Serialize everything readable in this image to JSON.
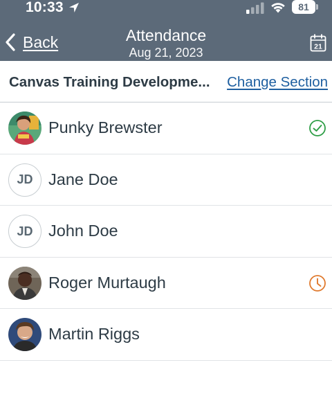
{
  "status_bar": {
    "time": "10:33",
    "battery": "81",
    "icons": [
      "location-arrow-icon",
      "cellular-signal-icon",
      "wifi-icon",
      "battery-icon"
    ]
  },
  "nav": {
    "back_label": "Back",
    "title": "Attendance",
    "subtitle": "Aug 21, 2023",
    "calendar_day": "21",
    "bar_color": "#5c6a79"
  },
  "section": {
    "name": "Canvas Training Developme...",
    "change_label": "Change Section",
    "link_color": "#1e5fa0"
  },
  "students": [
    {
      "name": "Punky Brewster",
      "avatar": "photo",
      "status": "present",
      "status_icon": "check-circle-icon",
      "status_color": "#2e9e46"
    },
    {
      "name": "Jane Doe",
      "avatar": "initials",
      "initials": "JD",
      "status": "unmarked"
    },
    {
      "name": "John Doe",
      "avatar": "initials",
      "initials": "JD",
      "status": "unmarked"
    },
    {
      "name": "Roger Murtaugh",
      "avatar": "photo",
      "status": "late",
      "status_icon": "clock-icon",
      "status_color": "#e07a2e"
    },
    {
      "name": "Martin Riggs",
      "avatar": "photo",
      "status": "unmarked"
    }
  ]
}
